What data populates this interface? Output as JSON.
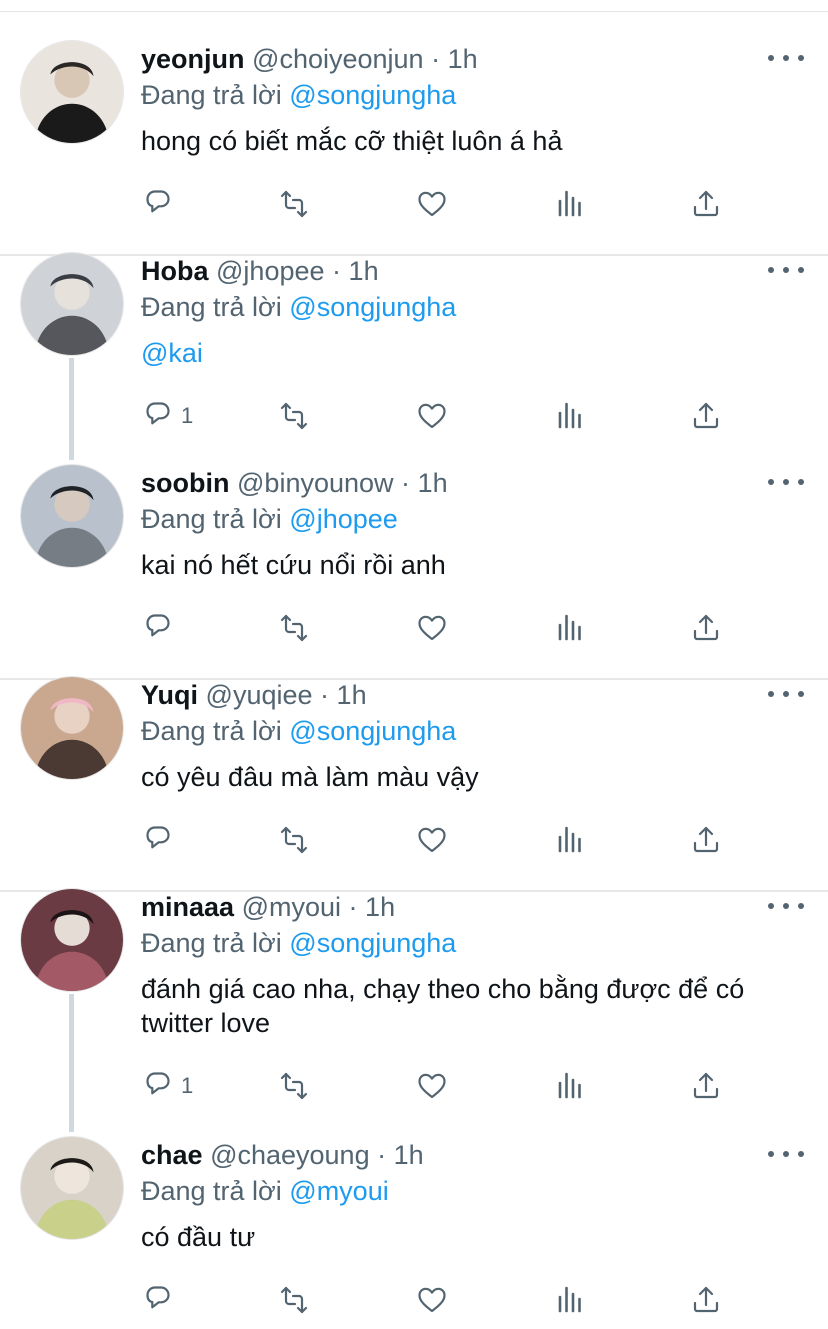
{
  "meta_sep": "·",
  "replying_prefix": "Đang trả lời",
  "icons": {
    "reply": "reply-icon",
    "retweet": "retweet-icon",
    "like": "heart-icon",
    "views": "analytics-icon",
    "share": "share-icon",
    "more": "more-icon"
  },
  "colors": {
    "mention": "#1d9bf0",
    "secondary": "#536471",
    "text": "#0f1419"
  },
  "tweets": [
    {
      "name": "yeonjun",
      "handle": "@choiyeonjun",
      "time": "1h",
      "replying_to": "@songjungha",
      "text": "hong có biết mắc cỡ thiệt luôn á hả",
      "reply_count": ""
    },
    {
      "name": "Hoba",
      "handle": "@jhopee",
      "time": "1h",
      "replying_to": "@songjungha",
      "text": "@kai",
      "reply_count": "1"
    },
    {
      "name": "soobin",
      "handle": "@binyounow",
      "time": "1h",
      "replying_to": "@jhopee",
      "text": "kai nó hết cứu nổi rồi anh",
      "reply_count": ""
    },
    {
      "name": "Yuqi",
      "handle": "@yuqiee",
      "time": "1h",
      "replying_to": "@songjungha",
      "text": "có yêu đâu mà làm màu vậy",
      "reply_count": ""
    },
    {
      "name": "minaaa",
      "handle": "@myoui",
      "time": "1h",
      "replying_to": "@songjungha",
      "text": "đánh giá cao nha, chạy theo cho bằng được để có twitter love",
      "reply_count": "1"
    },
    {
      "name": "chae",
      "handle": "@chaeyoung",
      "time": "1h",
      "replying_to": "@myoui",
      "text": "có đầu tư",
      "reply_count": ""
    }
  ]
}
